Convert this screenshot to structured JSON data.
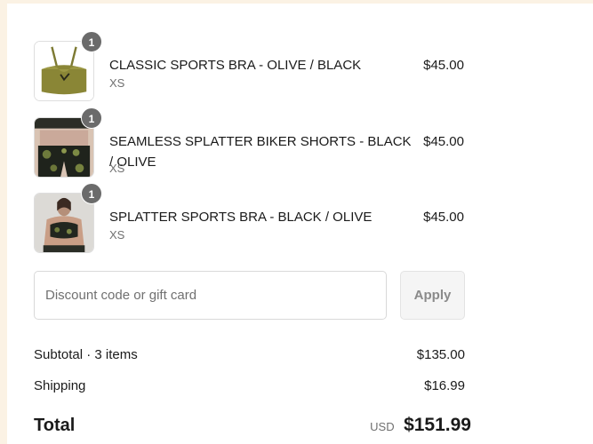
{
  "items": [
    {
      "quantity": "1",
      "name": "CLASSIC SPORTS BRA - OLIVE / BLACK",
      "variant": "XS",
      "price": "$45.00",
      "image": "olive-sports-bra-thumbnail"
    },
    {
      "quantity": "1",
      "name": "SEAMLESS SPLATTER BIKER SHORTS - BLACK / OLIVE",
      "variant": "XS",
      "price": "$45.00",
      "image": "biker-shorts-thumbnail"
    },
    {
      "quantity": "1",
      "name": "SPLATTER SPORTS BRA - BLACK / OLIVE",
      "variant": "XS",
      "price": "$45.00",
      "image": "splatter-bra-thumbnail"
    }
  ],
  "discount": {
    "placeholder": "Discount code or gift card",
    "apply_label": "Apply"
  },
  "summary": {
    "subtotal_label": "Subtotal · 3 items",
    "subtotal_value": "$135.00",
    "shipping_label": "Shipping",
    "shipping_value": "$16.99",
    "total_label": "Total",
    "total_currency": "USD",
    "total_value": "$151.99"
  },
  "colors": {
    "background": "#fbf2e4",
    "panel": "#ffffff",
    "badge": "#6b6b6b",
    "olive": "#8a8636"
  }
}
